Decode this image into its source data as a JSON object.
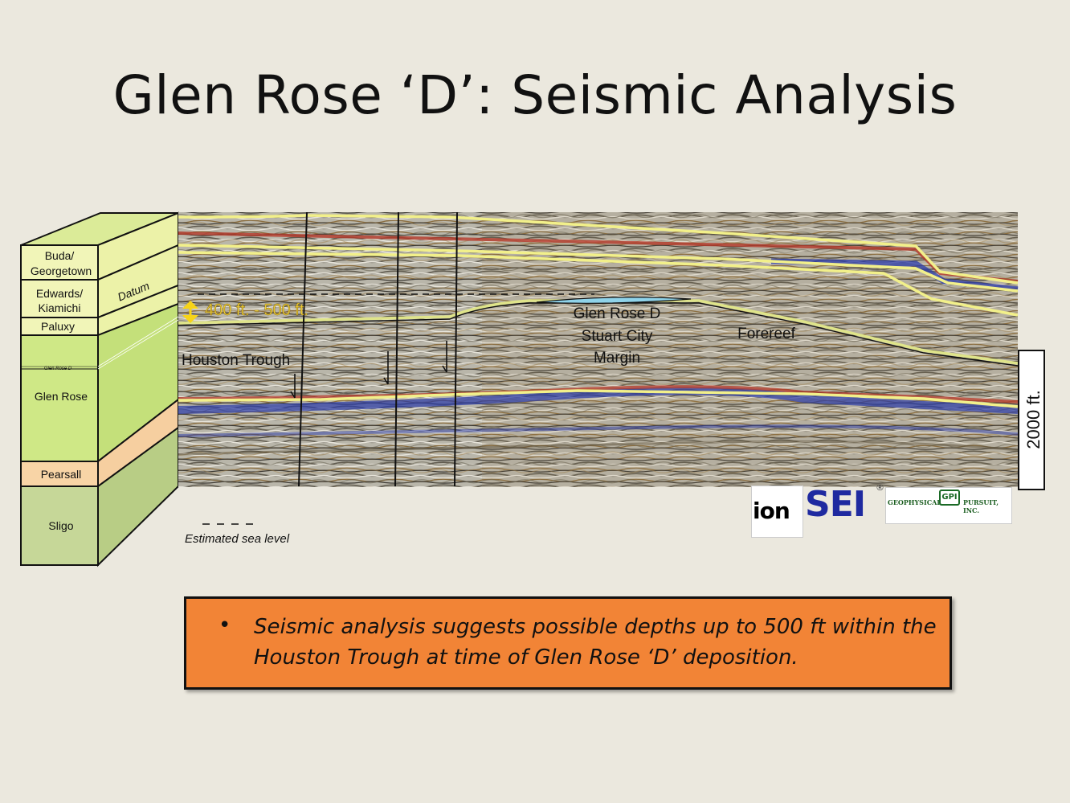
{
  "slide": {
    "title": "Glen Rose ‘D’: Seismic Analysis"
  },
  "column": {
    "units": [
      "Buda/\nGeorgetown",
      "Edwards/\nKiamichi",
      "Paluxy",
      "Glen Rose D",
      "Glen Rose",
      "Pearsall",
      "Sligo"
    ],
    "datum_label": "Datum"
  },
  "seismic": {
    "relief_label": "400 ft. - 500 ft.",
    "houston_trough": "Houston Trough",
    "margin_label": [
      "Glen Rose D",
      "Stuart City",
      "Margin"
    ],
    "forereef": "Forereef",
    "scale_label": "2000 ft."
  },
  "legend": {
    "sea_level": "Estimated sea level"
  },
  "callout": {
    "bullet": "•",
    "text": "Seismic analysis suggests possible depths up to 500 ft within the Houston Trough at time of Glen Rose ‘D’ deposition."
  },
  "logos": {
    "ion": "ion",
    "sei": "SEI",
    "sei_mark": "®",
    "gpi_left": "GEOPHYSICAL",
    "gpi_right": "PURSUIT, INC.",
    "gpi_mark": "GPI"
  },
  "colors": {
    "background": "#ebe8de",
    "column_green": "#cfe886",
    "column_yellow": "#f1f5b8",
    "pearsall": "#f8d4a6",
    "sligo": "#c6d798",
    "horizon_yellow": "#f2f08a",
    "callout_orange": "#f28436",
    "sei_blue": "#1f2aa0",
    "gpi_green": "#1b6a26"
  }
}
